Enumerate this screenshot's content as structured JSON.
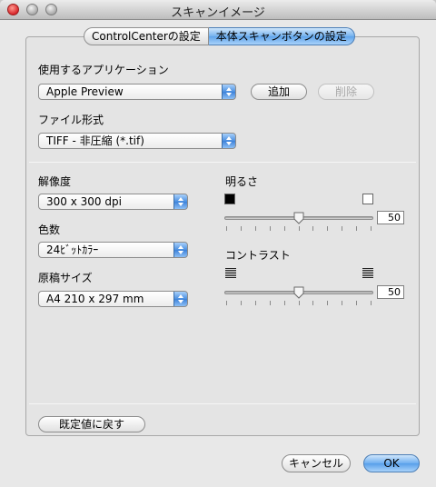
{
  "window": {
    "title": "スキャンイメージ"
  },
  "tabs": [
    {
      "label": "ControlCenterの設定",
      "active": false
    },
    {
      "label": "本体スキャンボタンの設定",
      "active": true
    }
  ],
  "application": {
    "label": "使用するアプリケーション",
    "selected": "Apple Preview",
    "add_label": "追加",
    "remove_label": "削除"
  },
  "file_format": {
    "label": "ファイル形式",
    "selected": "TIFF - 非圧縮 (*.tif)"
  },
  "resolution": {
    "label": "解像度",
    "selected": "300 x 300 dpi"
  },
  "color": {
    "label": "色数",
    "selected": "24ﾋﾞｯﾄｶﾗｰ"
  },
  "document_size": {
    "label": "原稿サイズ",
    "selected": "A4  210 x 297 mm"
  },
  "brightness": {
    "label": "明るさ",
    "value": "50",
    "level_fraction": 0.5
  },
  "contrast": {
    "label": "コントラスト",
    "value": "50",
    "level_fraction": 0.5
  },
  "buttons": {
    "restore_defaults": "既定値に戻す",
    "cancel": "キャンセル",
    "ok": "OK"
  }
}
